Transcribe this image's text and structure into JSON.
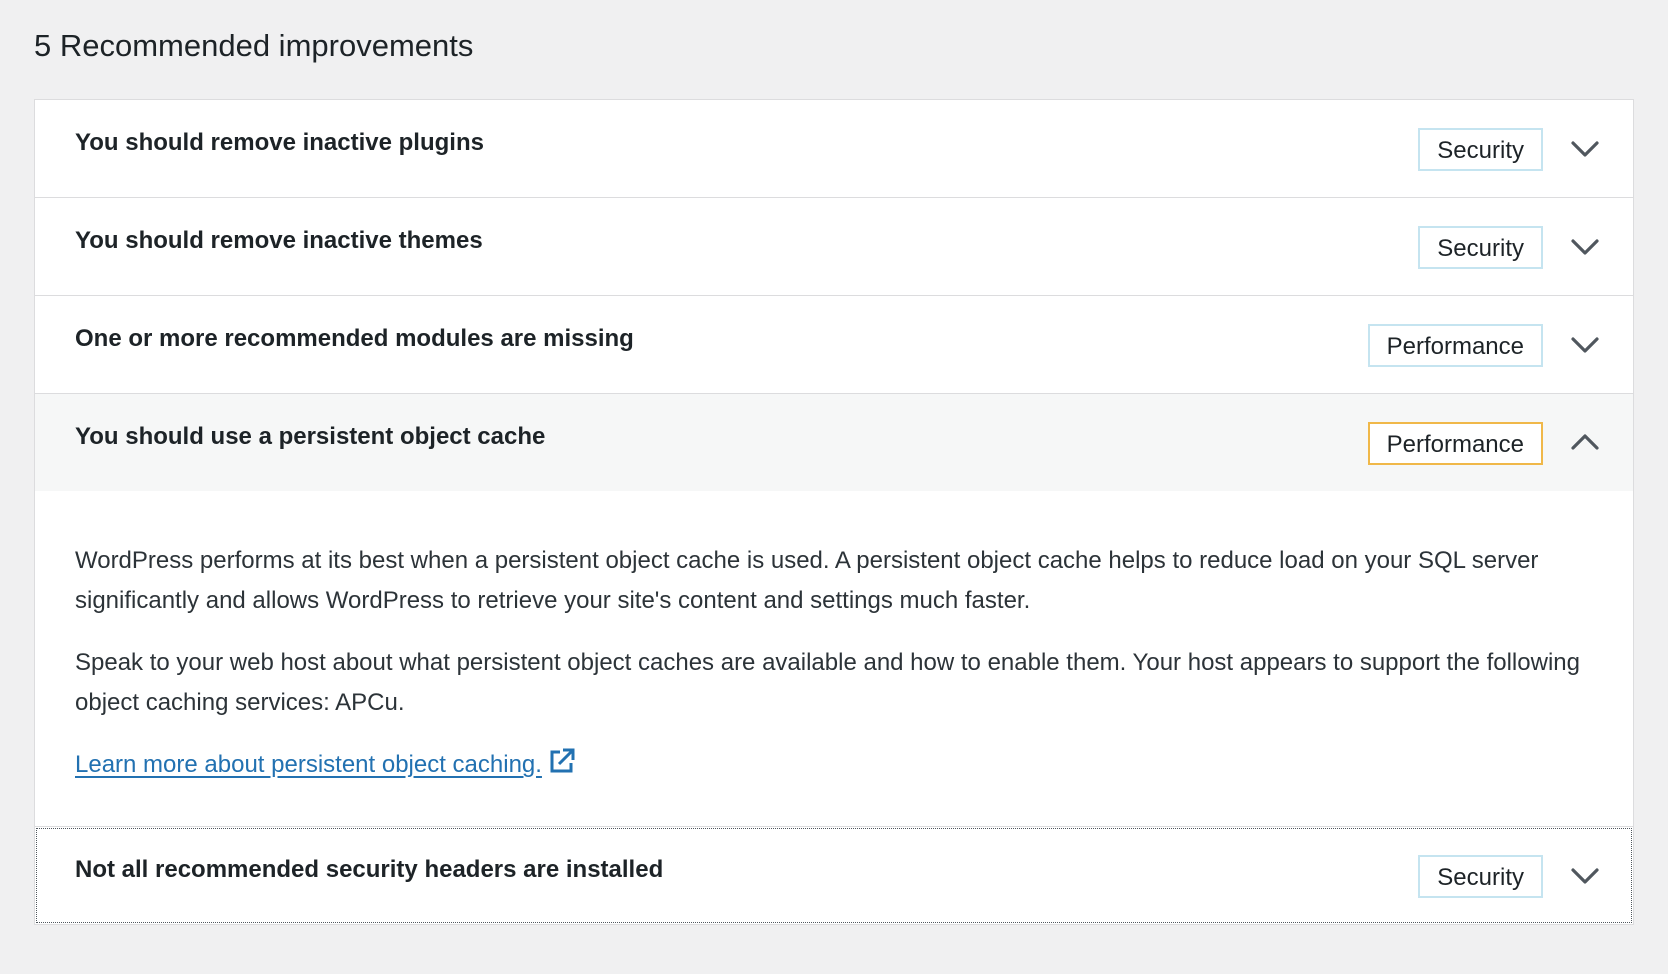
{
  "page": {
    "heading": "5 Recommended improvements"
  },
  "items": [
    {
      "title": "You should remove inactive plugins",
      "badge": "Security",
      "expanded": false
    },
    {
      "title": "You should remove inactive themes",
      "badge": "Security",
      "expanded": false
    },
    {
      "title": "One or more recommended modules are missing",
      "badge": "Performance",
      "expanded": false
    },
    {
      "title": "You should use a persistent object cache",
      "badge": "Performance",
      "expanded": true,
      "description": [
        "WordPress performs at its best when a persistent object cache is used. A persistent object cache helps to reduce load on your SQL server significantly and allows WordPress to retrieve your site's content and settings much faster.",
        "Speak to your web host about what persistent object caches are available and how to enable them. Your host appears to support the following object caching services: APCu."
      ],
      "link_text": "Learn more about persistent object caching."
    },
    {
      "title": "Not all recommended security headers are installed",
      "badge": "Security",
      "expanded": false
    }
  ],
  "icons": {
    "collapsed": "chevron-down-icon",
    "expanded": "chevron-up-icon",
    "external": "external-link-icon"
  },
  "colors": {
    "background": "#f0f0f1",
    "panel": "#ffffff",
    "open_header": "#f6f7f7",
    "badge_border": "#c5e4f0",
    "badge_highlight_border": "#f0b849",
    "link": "#2271b1",
    "text": "#1d2327"
  }
}
